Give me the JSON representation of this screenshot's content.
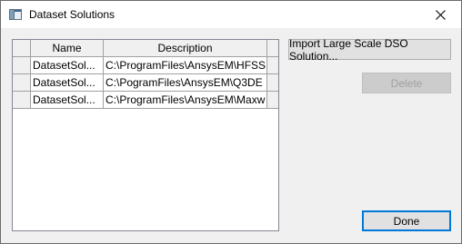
{
  "window": {
    "title": "Dataset Solutions",
    "icon": "window-icon",
    "close_icon": "close-icon"
  },
  "grid": {
    "columns": [
      "Name",
      "Description"
    ],
    "rows": [
      {
        "name": "DatasetSol...",
        "description": "C:\\ProgramFiles\\AnsysEM\\HFSS"
      },
      {
        "name": "DatasetSol...",
        "description": "C:\\PogramFiles\\AnsysEM\\Q3DE"
      },
      {
        "name": "DatasetSol...",
        "description": "C:\\ProgramFiles\\AnsysEM\\Maxw"
      }
    ]
  },
  "buttons": {
    "import_label": "Import Large Scale DSO Solution...",
    "delete_label": "Delete",
    "delete_enabled": false,
    "done_label": "Done"
  },
  "colors": {
    "accent": "#0078d7",
    "dialog_bg": "#f0f0f0",
    "disabled_text": "#a0a0a0"
  }
}
